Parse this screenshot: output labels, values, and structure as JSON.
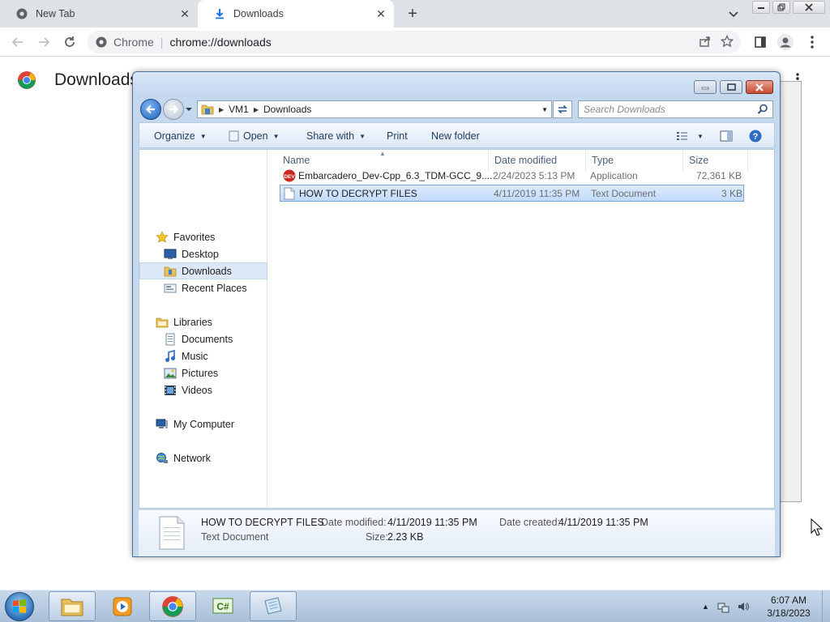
{
  "browser": {
    "tabs": [
      {
        "label": "New Tab",
        "icon": "chrome-icon"
      },
      {
        "label": "Downloads",
        "icon": "download-icon"
      }
    ],
    "omnibox": {
      "site": "Chrome",
      "url": "chrome://downloads"
    },
    "page_title": "Downloads"
  },
  "explorer": {
    "breadcrumb": [
      "VM1",
      "Downloads"
    ],
    "search_placeholder": "Search Downloads",
    "commands": {
      "organize": "Organize",
      "open": "Open",
      "share_with": "Share with",
      "print": "Print",
      "new_folder": "New folder"
    },
    "nav": {
      "favorites": "Favorites",
      "desktop": "Desktop",
      "downloads": "Downloads",
      "recent_places": "Recent Places",
      "libraries": "Libraries",
      "documents": "Documents",
      "music": "Music",
      "pictures": "Pictures",
      "videos": "Videos",
      "my_computer": "My Computer",
      "network": "Network"
    },
    "columns": {
      "name": "Name",
      "date_modified": "Date modified",
      "type": "Type",
      "size": "Size"
    },
    "files": [
      {
        "name": "Embarcadero_Dev-Cpp_6.3_TDM-GCC_9....",
        "date": "2/24/2023 5:13 PM",
        "type": "Application",
        "size": "72,361 KB",
        "selected": false
      },
      {
        "name": "HOW TO DECRYPT FILES",
        "date": "4/11/2019 11:35 PM",
        "type": "Text Document",
        "size": "3 KB",
        "selected": true
      }
    ],
    "details": {
      "name": "HOW TO DECRYPT FILES",
      "type": "Text Document",
      "modified_label": "Date modified:",
      "modified_value": "4/11/2019 11:35 PM",
      "created_label": "Date created:",
      "created_value": "4/11/2019 11:35 PM",
      "size_label": "Size:",
      "size_value": "2.23 KB"
    }
  },
  "taskbar": {
    "time": "6:07 AM",
    "date": "3/18/2023",
    "apps": [
      "explorer-icon",
      "media-player-icon",
      "chrome-icon",
      "csharp-icon",
      "notepad-icon"
    ]
  },
  "colors": {
    "accent": "#1a73e8",
    "explorer_frame": "#c4d8ee",
    "selection": "#c1dbfc"
  }
}
